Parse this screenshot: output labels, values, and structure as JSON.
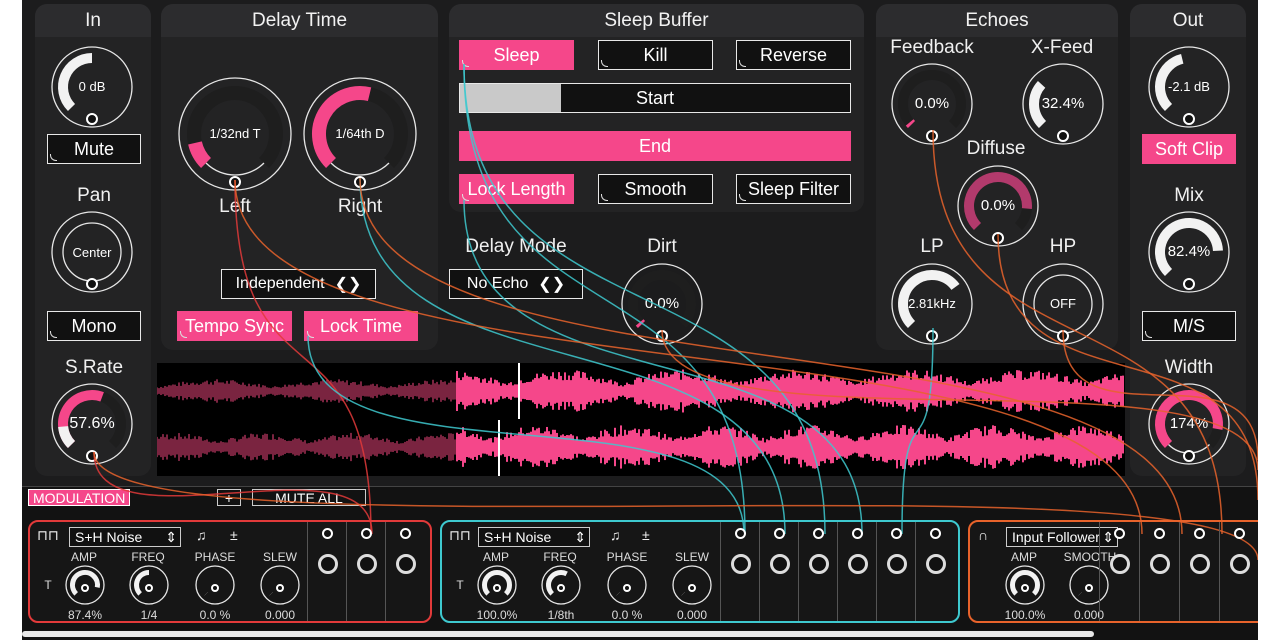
{
  "colors": {
    "accent": "#f5478a",
    "teal": "#3ec9cf",
    "orange": "#e8632b",
    "red": "#e23a3a"
  },
  "in": {
    "title": "In",
    "gain": "0 dB",
    "gain_level": 0.5,
    "mute": "Mute",
    "pan_label": "Pan",
    "pan": "Center",
    "mono": "Mono",
    "srate_label": "S.Rate",
    "srate": "57.6%",
    "srate_level": 0.576
  },
  "delay": {
    "title": "Delay Time",
    "left": "1/32nd T",
    "left_level": 0.12,
    "right": "1/64th D",
    "right_level": 0.55,
    "left_label": "Left",
    "right_label": "Right",
    "mode_select": "Independent",
    "tempo_sync": "Tempo Sync",
    "lock_time": "Lock Time"
  },
  "sleep": {
    "title": "Sleep Buffer",
    "sleep": "Sleep",
    "kill": "Kill",
    "reverse": "Reverse",
    "start": "Start",
    "start_level": 0.26,
    "end": "End",
    "lock_length": "Lock Length",
    "smooth": "Smooth",
    "sleep_filter": "Sleep Filter"
  },
  "delaymode": {
    "label": "Delay Mode",
    "value": "No Echo"
  },
  "dirt": {
    "label": "Dirt",
    "value": "0.0%",
    "level": 0.0
  },
  "echoes": {
    "title": "Echoes",
    "feedback_label": "Feedback",
    "feedback": "0.0%",
    "feedback_level": 0.0,
    "xfeed_label": "X-Feed",
    "xfeed": "32.4%",
    "xfeed_level": 0.324,
    "diffuse_label": "Diffuse",
    "diffuse": "0.0%",
    "diffuse_level": 0.0,
    "lp_label": "LP",
    "lp": "2.81kHz",
    "lp_level": 0.7,
    "hp_label": "HP",
    "hp": "OFF",
    "hp_level": 0.0
  },
  "out": {
    "title": "Out",
    "gain": "-2.1 dB",
    "gain_level": 0.45,
    "softclip": "Soft Clip",
    "mix_label": "Mix",
    "mix": "82.4%",
    "mix_level": 0.824,
    "ms": "M/S",
    "width_label": "Width",
    "width": "174%",
    "width_level": 0.87
  },
  "modulation": {
    "label": "MODULATION",
    "add": "+",
    "mute_all": "MUTE ALL",
    "mods": [
      {
        "type": "S+H Noise",
        "amp_label": "AMP",
        "amp": "87.4%",
        "amp_level": 0.874,
        "freq_label": "FREQ",
        "freq": "1/4",
        "freq_level": 0.5,
        "phase_label": "PHASE",
        "phase": "0.0 %",
        "phase_level": 0,
        "slew_label": "SLEW",
        "slew": "0.000",
        "slew_level": 0,
        "t": "T"
      },
      {
        "type": "S+H Noise",
        "amp_label": "AMP",
        "amp": "100.0%",
        "amp_level": 1,
        "freq_label": "FREQ",
        "freq": "1/8th",
        "freq_level": 0.6,
        "phase_label": "PHASE",
        "phase": "0.0 %",
        "phase_level": 0,
        "slew_label": "SLEW",
        "slew": "0.000",
        "slew_level": 0,
        "t": "T"
      },
      {
        "type": "Input Follower",
        "amp_label": "AMP",
        "amp": "100.0%",
        "amp_level": 1,
        "smooth_label": "SMOOTH",
        "smooth": "0.000",
        "smooth_level": 0
      }
    ]
  }
}
